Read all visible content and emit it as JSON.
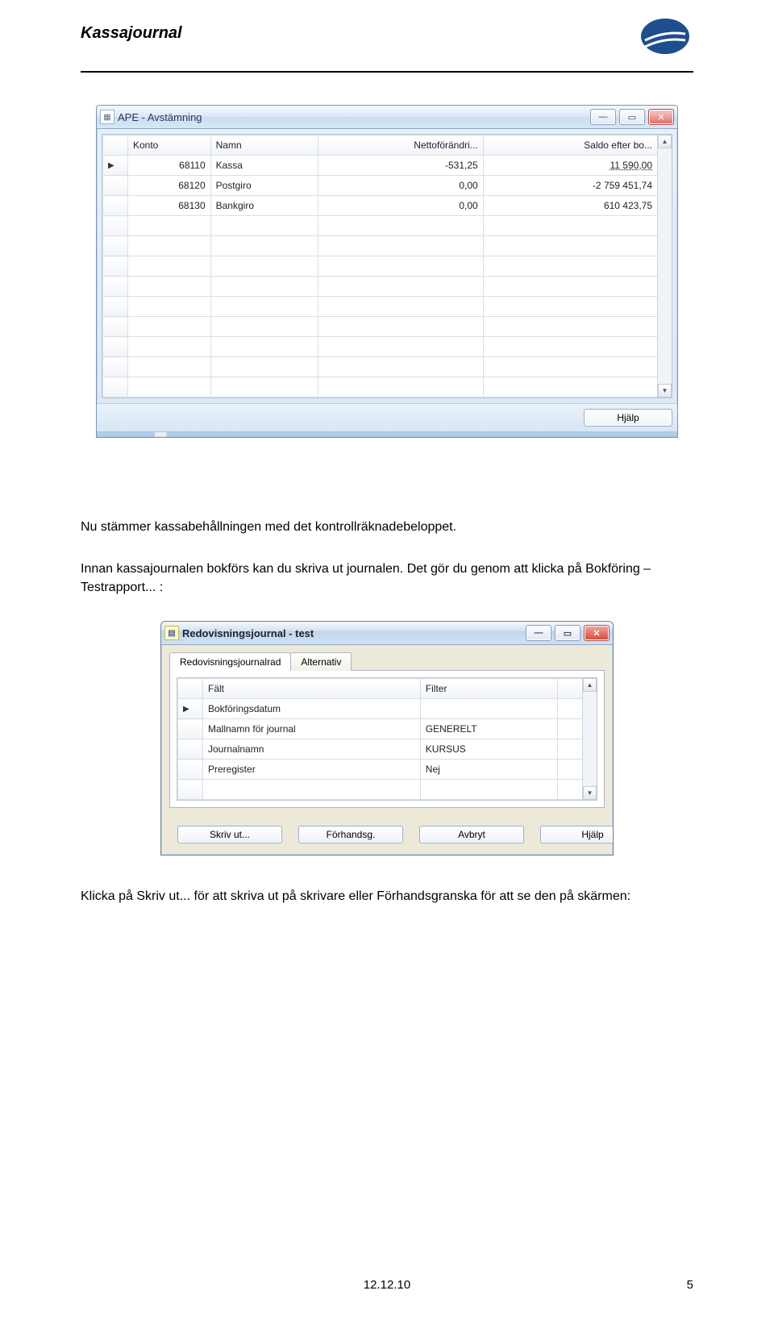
{
  "doc_header": "Kassajournal",
  "window1": {
    "title": "APE - Avstämning",
    "columns": [
      "Konto",
      "Namn",
      "Nettoförändri...",
      "Saldo efter bo..."
    ],
    "rows": [
      {
        "konto": "68110",
        "namn": "Kassa",
        "netto": "-531,25",
        "saldo": "11 590,00",
        "saldo_dotted": true
      },
      {
        "konto": "68120",
        "namn": "Postgiro",
        "netto": "0,00",
        "saldo": "-2 759 451,74"
      },
      {
        "konto": "68130",
        "namn": "Bankgiro",
        "netto": "0,00",
        "saldo": "610 423,75"
      }
    ],
    "help_btn": "Hjälp"
  },
  "para1": "Nu stämmer kassabehållningen med det kontrollräknadebeloppet.",
  "para2": "Innan kassajournalen bokförs kan du skriva ut journalen. Det gör du genom att klicka på Bokföring – Testrapport... :",
  "window2": {
    "title": "Redovisningsjournal - test",
    "tabs": [
      "Redovisningsjournalrad",
      "Alternativ"
    ],
    "columns": [
      "Fält",
      "Filter"
    ],
    "rows": [
      {
        "falt": "Bokföringsdatum",
        "filter": ""
      },
      {
        "falt": "Mallnamn för journal",
        "filter": "GENERELT"
      },
      {
        "falt": "Journalnamn",
        "filter": "KURSUS"
      },
      {
        "falt": "Preregister",
        "filter": "Nej"
      }
    ],
    "buttons": {
      "print": "Skriv ut...",
      "preview": "Förhandsg.",
      "cancel": "Avbryt",
      "help": "Hjälp"
    }
  },
  "para3": "Klicka på Skriv ut... för att skriva ut på skrivare eller Förhandsgranska för att se den på skärmen:",
  "footer_date": "12.12.10",
  "footer_page": "5"
}
